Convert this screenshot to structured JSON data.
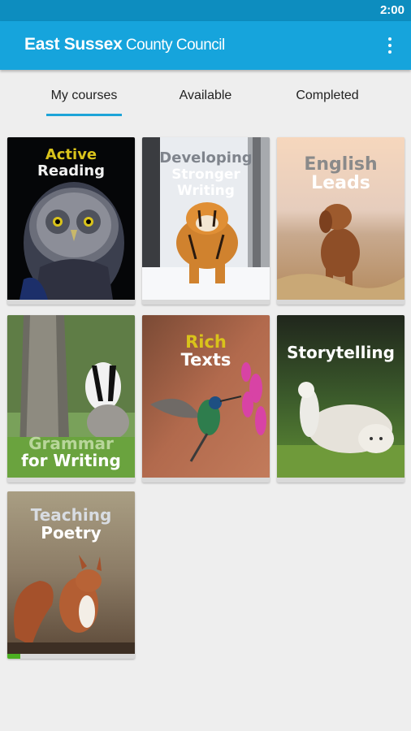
{
  "status_bar": {
    "time": "2:00"
  },
  "app_bar": {
    "title_bold": "East Sussex",
    "title_light": "County Council",
    "menu_icon": "more-vert-icon"
  },
  "tabs": [
    {
      "label": "My courses",
      "selected": true
    },
    {
      "label": "Available",
      "selected": false
    },
    {
      "label": "Completed",
      "selected": false
    }
  ],
  "colors": {
    "status_bar": "#0d8dbf",
    "app_bar": "#16a4dc",
    "tab_indicator": "#1da4d8",
    "progress": "#4caf22"
  },
  "courses": [
    {
      "line1": "Active",
      "line2": "Reading",
      "image": "owl"
    },
    {
      "line1": "Developing",
      "line2": "Stronger",
      "line3": "Writing",
      "image": "tiger"
    },
    {
      "line1": "English",
      "line2": "Leads",
      "image": "dog"
    },
    {
      "line1": "Grammar",
      "line2": "for Writing",
      "image": "badger"
    },
    {
      "line1": "Rich",
      "line2": "Texts",
      "image": "hummingbird"
    },
    {
      "line1": "Storytelling",
      "image": "alpaca-and-dog"
    },
    {
      "line1": "Teaching",
      "line2": "Poetry",
      "image": "squirrel",
      "progress": 0.1
    }
  ]
}
